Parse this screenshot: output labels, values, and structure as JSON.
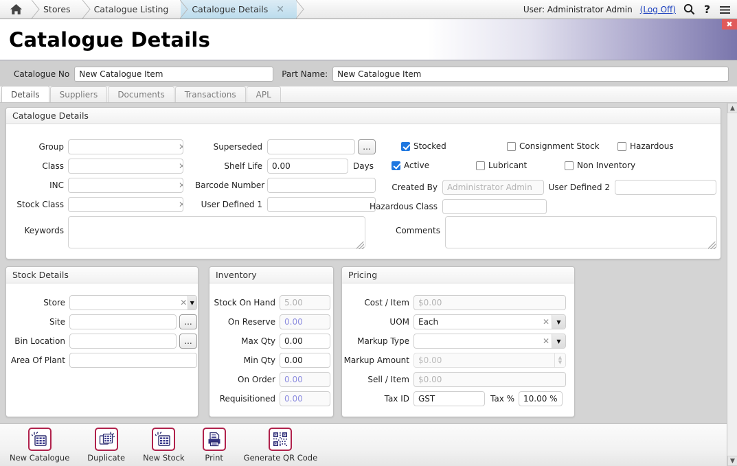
{
  "topbar": {
    "home_icon": "home-icon",
    "crumbs": [
      {
        "label": "Stores",
        "active": false
      },
      {
        "label": "Catalogue Listing",
        "active": false
      },
      {
        "label": "Catalogue Details",
        "active": true
      }
    ],
    "user_text": "User: Administrator Admin",
    "logoff_label": "(Log Off)",
    "search_icon": "search-icon",
    "help_icon": "help-icon",
    "menu_icon": "hamburger-menu-icon"
  },
  "banner": {
    "title": "Catalogue Details",
    "close_label": "✖"
  },
  "keyrow": {
    "catalogue_no_label": "Catalogue No",
    "catalogue_no_value": "New Catalogue Item",
    "part_name_label": "Part Name:",
    "part_name_value": "New Catalogue Item"
  },
  "tabs": [
    {
      "label": "Details",
      "selected": true
    },
    {
      "label": "Suppliers",
      "selected": false
    },
    {
      "label": "Documents",
      "selected": false
    },
    {
      "label": "Transactions",
      "selected": false
    },
    {
      "label": "APL",
      "selected": false
    }
  ],
  "catalogue_details": {
    "title": "Catalogue Details",
    "group_label": "Group",
    "group_value": "",
    "class_label": "Class",
    "class_value": "",
    "inc_label": "INC",
    "inc_value": "",
    "stock_class_label": "Stock Class",
    "stock_class_value": "",
    "keywords_label": "Keywords",
    "keywords_value": "",
    "superseded_label": "Superseded",
    "superseded_value": "",
    "superseded_browse_label": "...",
    "shelf_life_label": "Shelf Life",
    "shelf_life_value": "0.00",
    "shelf_life_units": "Days",
    "barcode_label": "Barcode Number",
    "barcode_value": "",
    "user_defined_1_label": "User Defined 1",
    "user_defined_1_value": "",
    "stocked_label": "Stocked",
    "stocked_checked": true,
    "consignment_label": "Consignment Stock",
    "consignment_checked": false,
    "hazardous_label": "Hazardous",
    "hazardous_checked": false,
    "active_label": "Active",
    "active_checked": true,
    "lubricant_label": "Lubricant",
    "lubricant_checked": false,
    "non_inventory_label": "Non Inventory",
    "non_inventory_checked": false,
    "created_by_label": "Created By",
    "created_by_value": "Administrator Admin",
    "user_defined_2_label": "User Defined 2",
    "user_defined_2_value": "",
    "hazardous_class_label": "Hazardous Class",
    "hazardous_class_value": "",
    "comments_label": "Comments",
    "comments_value": ""
  },
  "stock_details": {
    "title": "Stock Details",
    "store_label": "Store",
    "store_value": "",
    "site_label": "Site",
    "site_value": "",
    "site_browse_label": "...",
    "bin_location_label": "Bin Location",
    "bin_location_value": "",
    "bin_browse_label": "...",
    "area_of_plant_label": "Area Of Plant",
    "area_of_plant_value": ""
  },
  "inventory": {
    "title": "Inventory",
    "rows": [
      {
        "label": "Stock On Hand",
        "value": "5.00",
        "readonly": true,
        "blue": false
      },
      {
        "label": "On Reserve",
        "value": "0.00",
        "readonly": true,
        "blue": true
      },
      {
        "label": "Max Qty",
        "value": "0.00",
        "readonly": false,
        "blue": false
      },
      {
        "label": "Min Qty",
        "value": "0.00",
        "readonly": false,
        "blue": false
      },
      {
        "label": "On Order",
        "value": "0.00",
        "readonly": true,
        "blue": true
      },
      {
        "label": "Requisitioned",
        "value": "0.00",
        "readonly": true,
        "blue": true
      }
    ]
  },
  "pricing": {
    "title": "Pricing",
    "cost_label": "Cost / Item",
    "cost_value": "$0.00",
    "uom_label": "UOM",
    "uom_value": "Each",
    "markup_type_label": "Markup Type",
    "markup_type_value": "",
    "markup_amount_label": "Markup Amount",
    "markup_amount_value": "$0.00",
    "sell_label": "Sell / Item",
    "sell_value": "$0.00",
    "tax_id_label": "Tax ID",
    "tax_id_value": "GST",
    "tax_pct_label": "Tax %",
    "tax_pct_value": "10.00 %"
  },
  "toolbar": [
    {
      "label": "New Catalogue",
      "icon": "new-catalogue-icon"
    },
    {
      "label": "Duplicate",
      "icon": "duplicate-icon"
    },
    {
      "label": "New Stock",
      "icon": "new-stock-icon"
    },
    {
      "label": "Print",
      "icon": "print-icon"
    },
    {
      "label": "Generate QR Code",
      "icon": "qr-code-icon"
    }
  ],
  "colors": {
    "accent_purple": "#7a76ac",
    "close_red": "#e05a5a",
    "checkbox_blue": "#1e77e0",
    "icon_crimson": "#b0214b",
    "link_blue": "#1a3fbf"
  }
}
